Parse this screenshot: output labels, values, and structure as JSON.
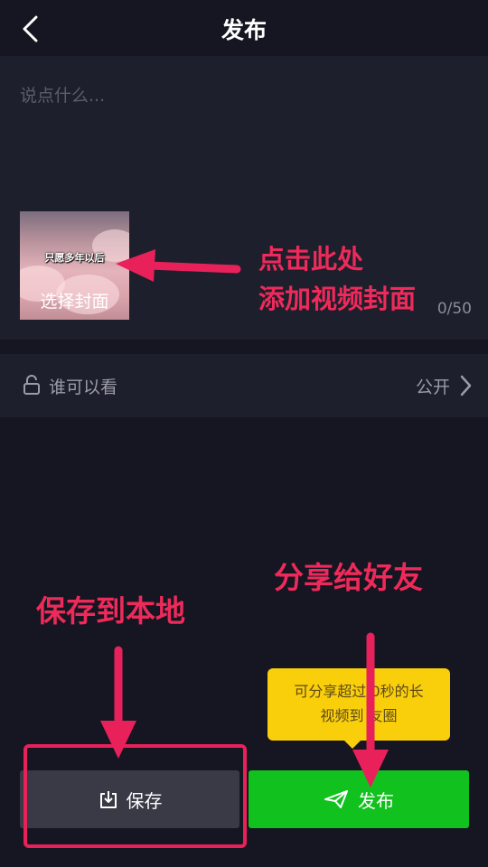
{
  "header": {
    "title": "发布"
  },
  "compose": {
    "placeholder": "说点什么...",
    "cover_text": "只愿多年以后",
    "cover_label": "选择封面",
    "counter": "0/50"
  },
  "privacy": {
    "label": "谁可以看",
    "value": "公开"
  },
  "annotations": {
    "cover_line1": "点击此处",
    "cover_line2": "添加视频封面",
    "save_hint": "保存到本地",
    "share_hint": "分享给好友"
  },
  "tooltip": {
    "line1": "可分享超过 0秒的长",
    "line2": "视频到 友圈"
  },
  "actions": {
    "save_label": "保存",
    "publish_label": "发布"
  },
  "colors": {
    "background": "#151622",
    "panel": "#1e1f2c",
    "annotation": "#ef2a5a",
    "publish_green": "#11c11d",
    "tooltip_yellow": "#f9ce0a"
  },
  "icons": {
    "back": "chevron-left-icon",
    "lock": "lock-icon",
    "chevron": "chevron-right-icon",
    "save": "download-icon",
    "publish": "send-icon"
  }
}
